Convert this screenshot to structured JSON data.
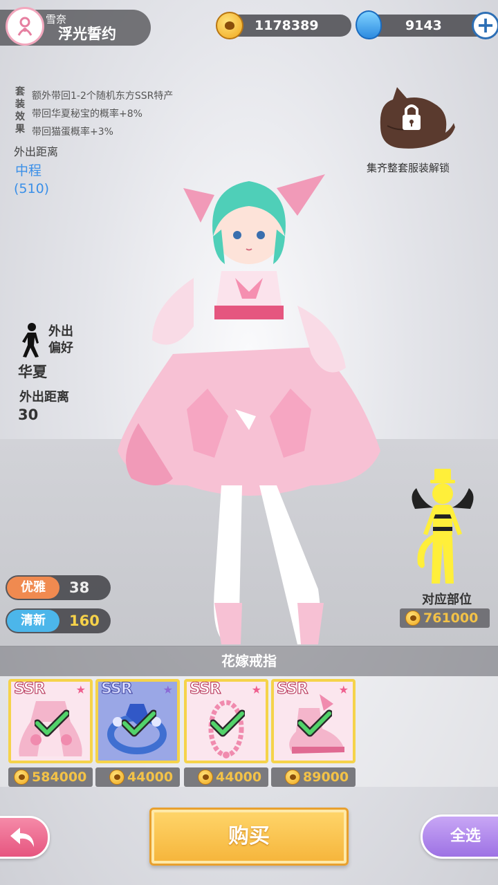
{
  "header": {
    "character_name": "雪奈",
    "outfit_name": "浮光誓约",
    "gold": "1178389",
    "gems": "9143"
  },
  "set_bonus": {
    "label": "套装效果",
    "effects": [
      "额外带回1-2个随机东方SSR特产",
      "带回华夏秘宝的概率+8%",
      "带回猫蛋概率+3%"
    ]
  },
  "outing": {
    "distance_label": "外出距离",
    "distance_class": "中程",
    "distance_value": "(510)",
    "preference_label": "外出偏好",
    "preference_value": "华夏",
    "distance_label_2": "外出距离",
    "distance_value_2": "30"
  },
  "lock": {
    "text": "集齐整套服装解锁"
  },
  "stats": {
    "elegant_label": "优雅",
    "elegant_value": "38",
    "fresh_label": "清新",
    "fresh_value": "160"
  },
  "slot": {
    "label": "对应部位",
    "price": "761000"
  },
  "item_bar": {
    "title": "花嫁戒指",
    "items": [
      {
        "rarity": "SSR",
        "price": "584000",
        "selected": true,
        "icon": "dress-icon"
      },
      {
        "rarity": "SSR",
        "price": "44000",
        "selected": true,
        "icon": "ring-icon"
      },
      {
        "rarity": "SSR",
        "price": "44000",
        "selected": true,
        "icon": "necklace-icon"
      },
      {
        "rarity": "SSR",
        "price": "89000",
        "selected": true,
        "icon": "shoes-icon"
      }
    ]
  },
  "buttons": {
    "buy": "购买",
    "select_all": "全选"
  },
  "colors": {
    "elegant": "#f08a50",
    "fresh": "#4cb6ea",
    "card_border": "#f5d34a",
    "buy": "#f5b43a",
    "select_all": "#9d72e4",
    "back": "#e6557f"
  }
}
